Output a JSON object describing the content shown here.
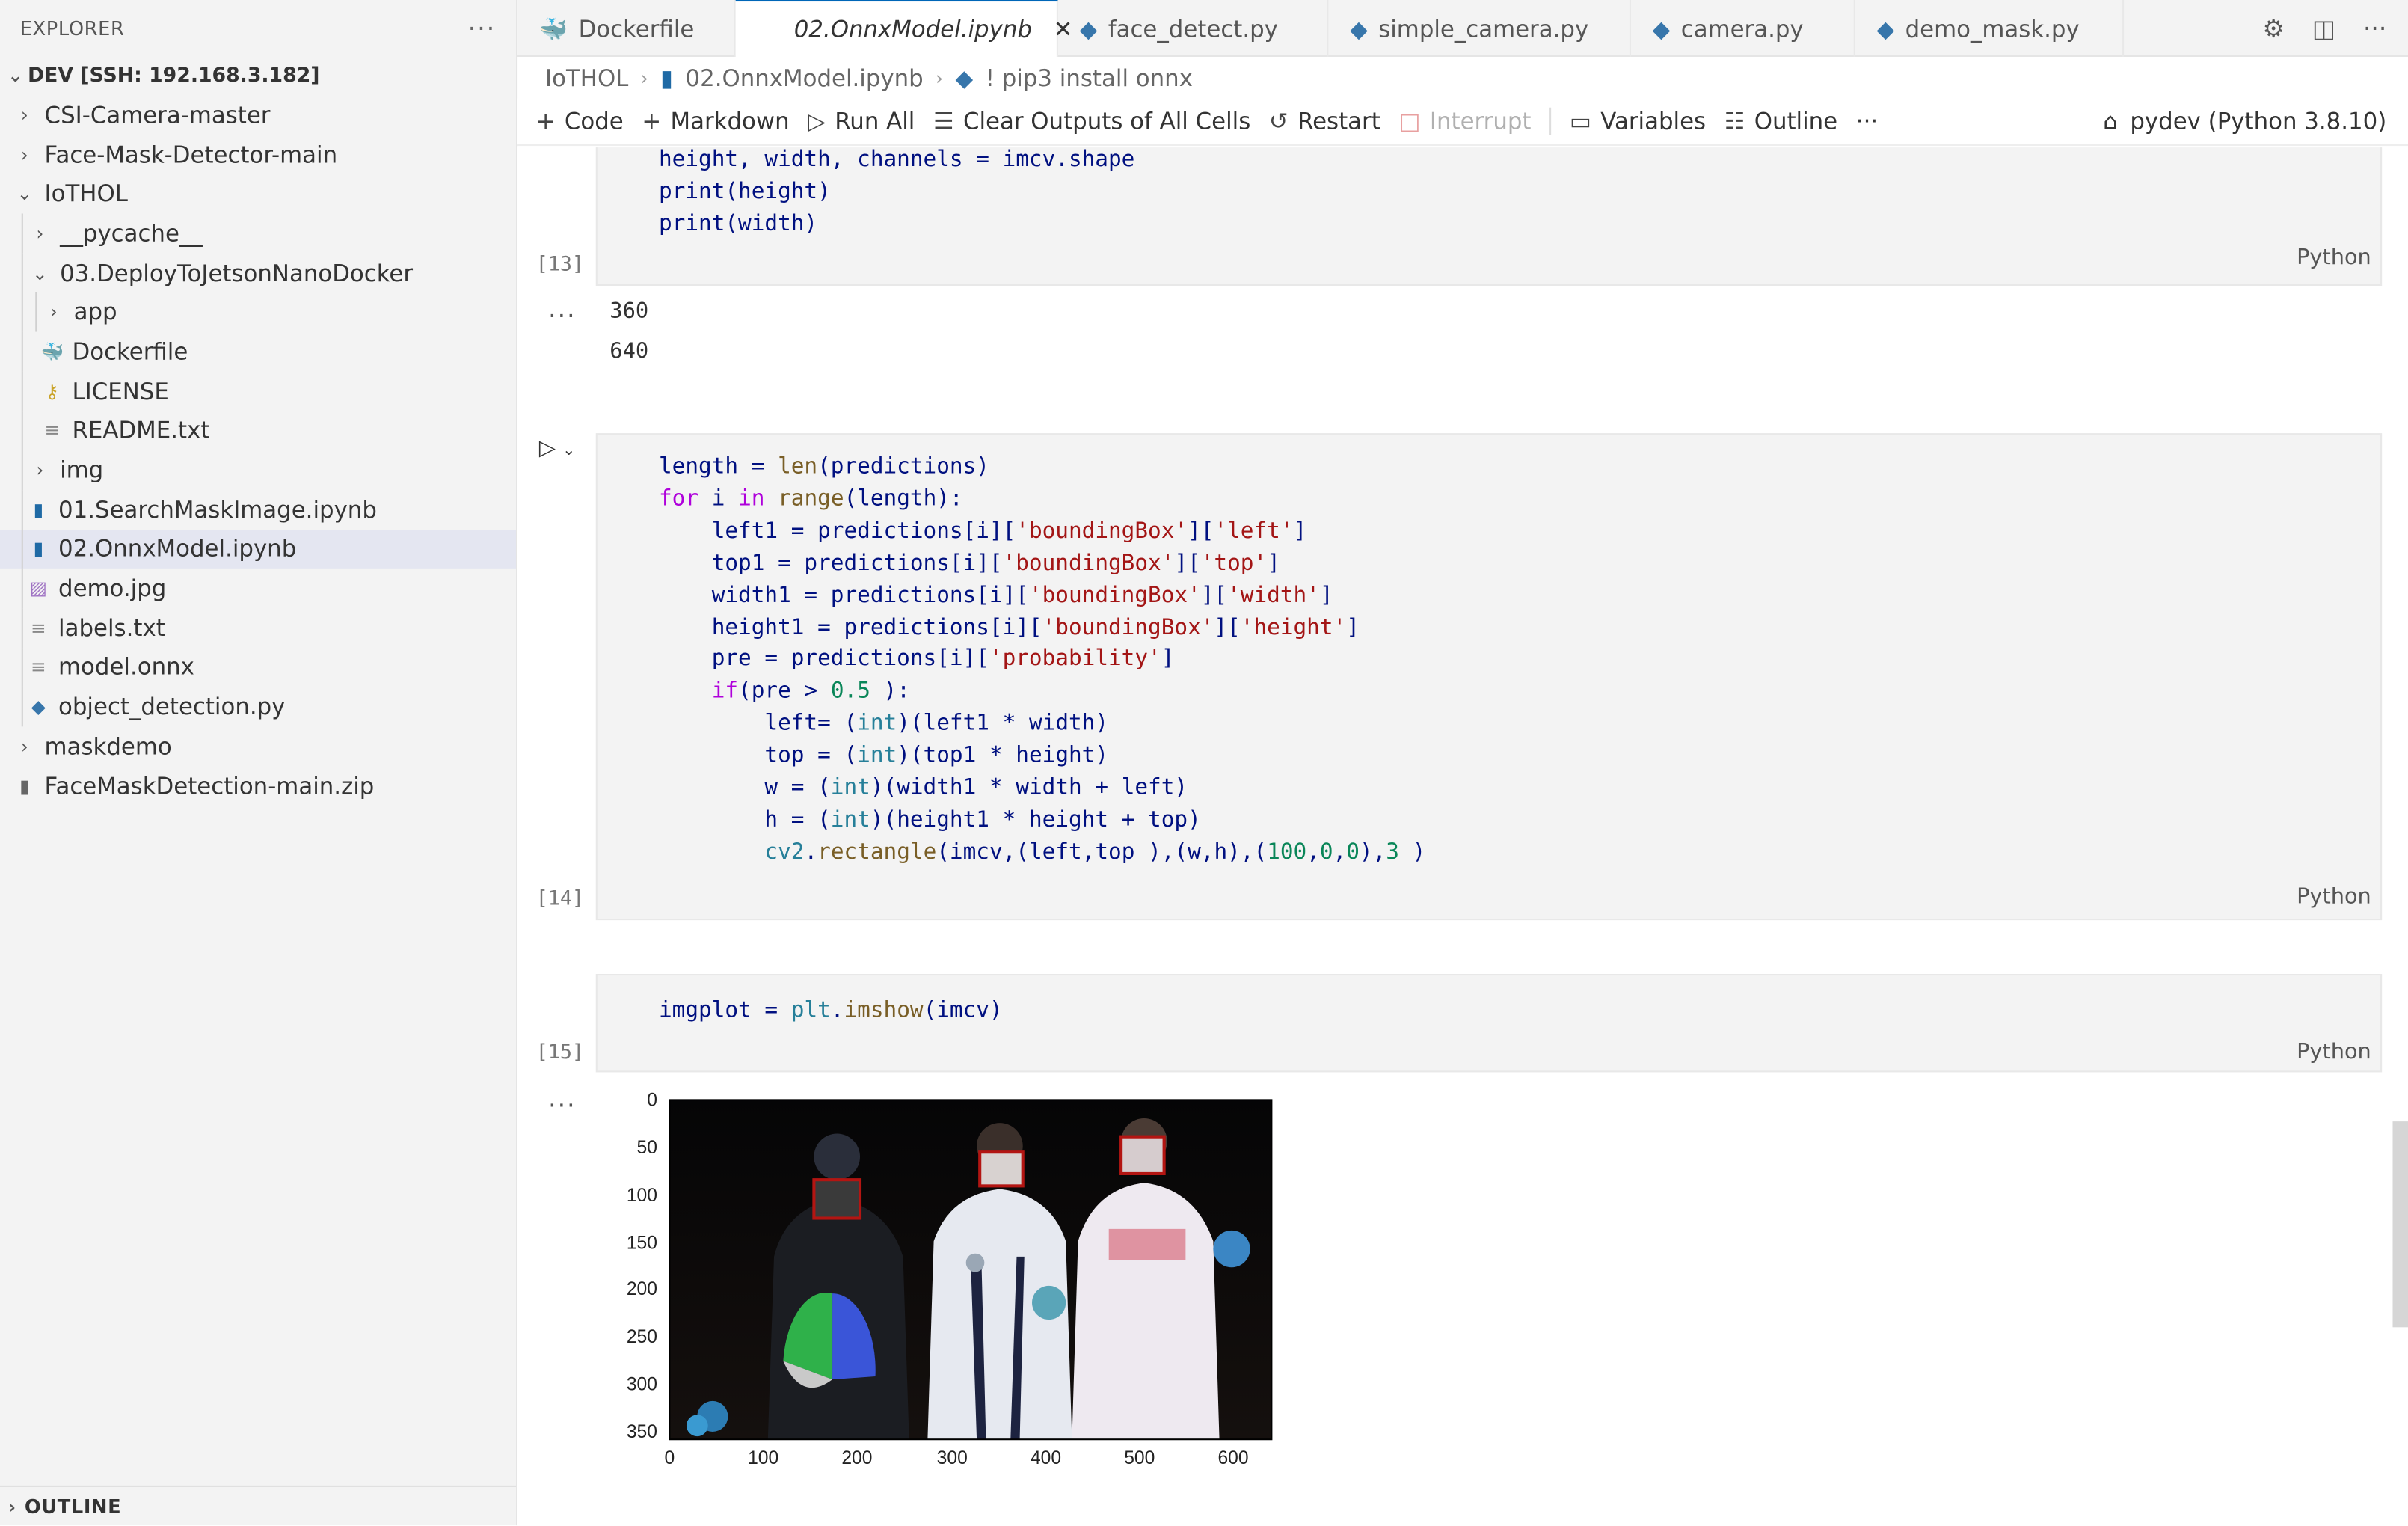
{
  "sidebar": {
    "title": "EXPLORER",
    "more": "···",
    "root": "DEV [SSH: 192.168.3.182]",
    "items": [
      {
        "label": "CSI-Camera-master",
        "twisty": "›"
      },
      {
        "label": "Face-Mask-Detector-main",
        "twisty": "›"
      },
      {
        "label": "IoTHOL",
        "twisty": "⌄"
      },
      {
        "label": "__pycache__",
        "twisty": "›"
      },
      {
        "label": "03.DeployToJetsonNanoDocker",
        "twisty": "⌄"
      },
      {
        "label": "app",
        "twisty": "›"
      },
      {
        "label": "Dockerfile",
        "icon": "docker-icon"
      },
      {
        "label": "LICENSE",
        "icon": "license-icon"
      },
      {
        "label": "README.txt",
        "icon": "text-file-icon"
      },
      {
        "label": "img",
        "twisty": "›"
      },
      {
        "label": "01.SearchMaskImage.ipynb",
        "icon": "notebook-icon"
      },
      {
        "label": "02.OnnxModel.ipynb",
        "icon": "notebook-icon"
      },
      {
        "label": "demo.jpg",
        "icon": "image-icon"
      },
      {
        "label": "labels.txt",
        "icon": "text-file-icon"
      },
      {
        "label": "model.onnx",
        "icon": "text-file-icon"
      },
      {
        "label": "object_detection.py",
        "icon": "python-icon"
      },
      {
        "label": "maskdemo",
        "twisty": "›"
      },
      {
        "label": "FaceMaskDetection-main.zip",
        "icon": "zip-icon"
      }
    ],
    "outline": "OUTLINE"
  },
  "tabs": [
    {
      "label": "Dockerfile"
    },
    {
      "label": "02.OnnxModel.ipynb",
      "close": "✕"
    },
    {
      "label": "face_detect.py"
    },
    {
      "label": "simple_camera.py"
    },
    {
      "label": "camera.py"
    },
    {
      "label": "demo_mask.py"
    }
  ],
  "breadcrumb": [
    "IoTHOL",
    "02.OnnxModel.ipynb",
    "! pip3 install onnx"
  ],
  "toolbar": {
    "code": "Code",
    "markdown": "Markdown",
    "run_all": "Run All",
    "clear": "Clear Outputs of All Cells",
    "restart": "Restart",
    "interrupt": "Interrupt",
    "variables": "Variables",
    "outline": "Outline",
    "more": "···",
    "kernel": "pydev (Python 3.8.10)"
  },
  "cells": {
    "c13": {
      "exec": "[13]",
      "lang": "Python",
      "lines": [
        "height, width, channels = imcv.shape",
        "print(height)",
        "print(width)"
      ]
    },
    "out13": {
      "dots": "···",
      "lines": [
        "360",
        "640"
      ]
    },
    "c14": {
      "exec": "[14]",
      "lang": "Python"
    },
    "c15": {
      "exec": "[15]",
      "lang": "Python"
    },
    "out15": {
      "dots": "···"
    }
  },
  "plot": {
    "y_ticks": [
      "0",
      "50",
      "100",
      "150",
      "200",
      "250",
      "300",
      "350"
    ],
    "x_ticks": [
      "0",
      "100",
      "200",
      "300",
      "400",
      "500",
      "600"
    ]
  },
  "colors": {
    "accent": "#0066b8",
    "keyword": "#af00db",
    "string": "#a31515",
    "number": "#098658"
  }
}
